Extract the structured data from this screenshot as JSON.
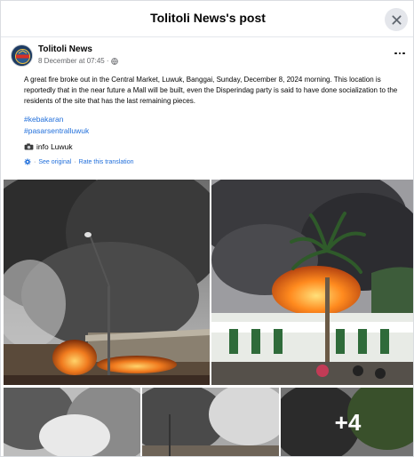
{
  "dialog": {
    "title": "Tolitoli News's post",
    "close_icon": "close-icon"
  },
  "post": {
    "author": "Tolitoli News",
    "timestamp": "8 December at 07:45 ·",
    "audience_icon": "globe-icon",
    "more_icon": "more-options-icon",
    "body": "A great fire broke out in the Central Market, Luwuk, Banggai, Sunday, December 8, 2024 morning. This location is reportedly that in the near future a Mall will be built, even the Disperindag party is said to have done socialization to the residents of the site that has the last remaining pieces.",
    "hashtags": [
      "#kebakaran",
      "#pasarsentralluwuk"
    ],
    "info_icon": "camera-icon",
    "info_text": "info Luwuk",
    "see_original": "See original",
    "rate_translation": "Rate this translation",
    "separator": "·",
    "more_photos": "+4"
  },
  "colors": {
    "link": "#216fdb",
    "secondary_text": "#65676b",
    "fire": "#f07a1e",
    "smoke": "#3a3a3a"
  }
}
